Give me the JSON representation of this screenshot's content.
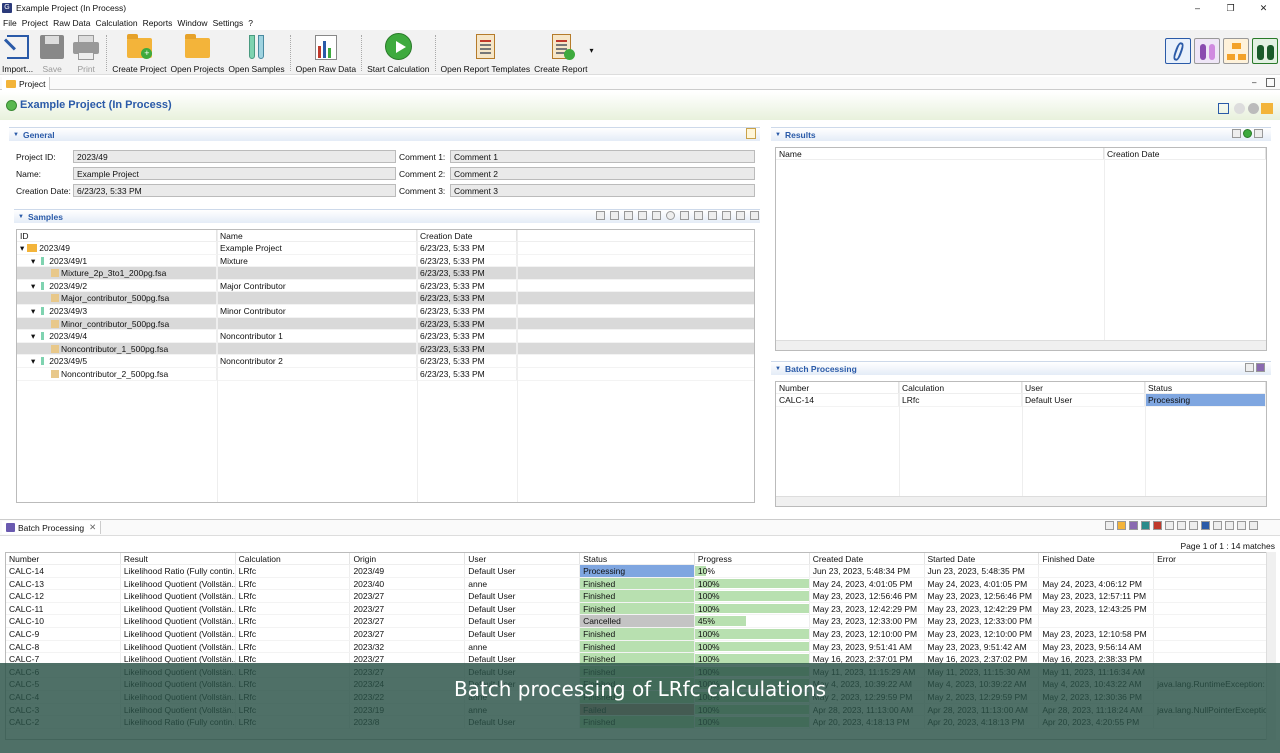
{
  "window": {
    "title": "Example Project (In Process)",
    "app_icon": "G"
  },
  "menu": [
    "File",
    "Project",
    "Raw Data",
    "Calculation",
    "Reports",
    "Window",
    "Settings",
    "?"
  ],
  "toolbar": {
    "import": "Import...",
    "save": "Save",
    "print": "Print",
    "create_project": "Create Project",
    "open_projects": "Open Projects",
    "open_samples": "Open Samples",
    "open_raw_data": "Open Raw Data",
    "start_calculation": "Start Calculation",
    "open_report_templates": "Open Report Templates",
    "create_report": "Create Report"
  },
  "project_tab": "Project",
  "project_title": "Example Project (In Process)",
  "general": {
    "header": "General",
    "project_id_label": "Project ID:",
    "project_id": "2023/49",
    "name_label": "Name:",
    "name": "Example Project",
    "creation_label": "Creation Date:",
    "creation": "6/23/23, 5:33 PM",
    "c1_label": "Comment 1:",
    "c1": "Comment 1",
    "c2_label": "Comment 2:",
    "c2": "Comment 2",
    "c3_label": "Comment 3:",
    "c3": "Comment 3"
  },
  "samples": {
    "header": "Samples",
    "cols": [
      "ID",
      "Name",
      "Creation Date"
    ],
    "rows": [
      {
        "id": "2023/49",
        "name": "Example Project",
        "date": "6/23/23, 5:33 PM",
        "level": 0,
        "kind": "folder"
      },
      {
        "id": "2023/49/1",
        "name": "Mixture",
        "date": "6/23/23, 5:33 PM",
        "level": 1,
        "kind": "tube"
      },
      {
        "id": "Mixture_2p_3to1_200pg.fsa",
        "name": "",
        "date": "6/23/23, 5:33 PM",
        "level": 2,
        "kind": "file",
        "sel": true
      },
      {
        "id": "2023/49/2",
        "name": "Major Contributor",
        "date": "6/23/23, 5:33 PM",
        "level": 1,
        "kind": "tube"
      },
      {
        "id": "Major_contributor_500pg.fsa",
        "name": "",
        "date": "6/23/23, 5:33 PM",
        "level": 2,
        "kind": "file",
        "sel": true
      },
      {
        "id": "2023/49/3",
        "name": "Minor Contributor",
        "date": "6/23/23, 5:33 PM",
        "level": 1,
        "kind": "tube"
      },
      {
        "id": "Minor_contributor_500pg.fsa",
        "name": "",
        "date": "6/23/23, 5:33 PM",
        "level": 2,
        "kind": "file",
        "sel": true
      },
      {
        "id": "2023/49/4",
        "name": "Noncontributor 1",
        "date": "6/23/23, 5:33 PM",
        "level": 1,
        "kind": "tube"
      },
      {
        "id": "Noncontributor_1_500pg.fsa",
        "name": "",
        "date": "6/23/23, 5:33 PM",
        "level": 2,
        "kind": "file",
        "sel": true
      },
      {
        "id": "2023/49/5",
        "name": "Noncontributor 2",
        "date": "6/23/23, 5:33 PM",
        "level": 1,
        "kind": "tube"
      },
      {
        "id": "Noncontributor_2_500pg.fsa",
        "name": "",
        "date": "6/23/23, 5:33 PM",
        "level": 2,
        "kind": "file"
      }
    ]
  },
  "results": {
    "header": "Results",
    "cols": [
      "Name",
      "Creation Date"
    ]
  },
  "batch_small": {
    "header": "Batch Processing",
    "cols": [
      "Number",
      "Calculation",
      "User",
      "Status"
    ],
    "rows": [
      {
        "number": "CALC-14",
        "calc": "LRfc",
        "user": "Default User",
        "status": "Processing"
      }
    ]
  },
  "batch": {
    "tab": "Batch Processing",
    "page_info": "Page 1 of 1 : 14 matches",
    "cols": [
      "Number",
      "Result",
      "Calculation",
      "Origin",
      "User",
      "Status",
      "Progress",
      "Created Date",
      "Started Date",
      "Finished Date",
      "Error"
    ],
    "rows": [
      {
        "number": "CALC-14",
        "result": "Likelihood Ratio (Fully contin...",
        "calc": "LRfc",
        "origin": "2023/49",
        "user": "Default User",
        "status": "Processing",
        "progress": "10%",
        "pct": 10,
        "created": "Jun 23, 2023, 5:48:34 PM",
        "started": "Jun 23, 2023, 5:48:35 PM",
        "finished": "",
        "error": ""
      },
      {
        "number": "CALC-13",
        "result": "Likelihood Quotient (Vollstän...",
        "calc": "LRfc",
        "origin": "2023/40",
        "user": "anne",
        "status": "Finished",
        "progress": "100%",
        "pct": 100,
        "created": "May 24, 2023, 4:01:05 PM",
        "started": "May 24, 2023, 4:01:05 PM",
        "finished": "May 24, 2023, 4:06:12 PM",
        "error": ""
      },
      {
        "number": "CALC-12",
        "result": "Likelihood Quotient (Vollstän...",
        "calc": "LRfc",
        "origin": "2023/27",
        "user": "Default User",
        "status": "Finished",
        "progress": "100%",
        "pct": 100,
        "created": "May 23, 2023, 12:56:46 PM",
        "started": "May 23, 2023, 12:56:46 PM",
        "finished": "May 23, 2023, 12:57:11 PM",
        "error": ""
      },
      {
        "number": "CALC-11",
        "result": "Likelihood Quotient (Vollstän...",
        "calc": "LRfc",
        "origin": "2023/27",
        "user": "Default User",
        "status": "Finished",
        "progress": "100%",
        "pct": 100,
        "created": "May 23, 2023, 12:42:29 PM",
        "started": "May 23, 2023, 12:42:29 PM",
        "finished": "May 23, 2023, 12:43:25 PM",
        "error": ""
      },
      {
        "number": "CALC-10",
        "result": "Likelihood Quotient (Vollstän...",
        "calc": "LRfc",
        "origin": "2023/27",
        "user": "Default User",
        "status": "Cancelled",
        "progress": "45%",
        "pct": 45,
        "created": "May 23, 2023, 12:33:00 PM",
        "started": "May 23, 2023, 12:33:00 PM",
        "finished": "",
        "error": ""
      },
      {
        "number": "CALC-9",
        "result": "Likelihood Quotient (Vollstän...",
        "calc": "LRfc",
        "origin": "2023/27",
        "user": "Default User",
        "status": "Finished",
        "progress": "100%",
        "pct": 100,
        "created": "May 23, 2023, 12:10:00 PM",
        "started": "May 23, 2023, 12:10:00 PM",
        "finished": "May 23, 2023, 12:10:58 PM",
        "error": ""
      },
      {
        "number": "CALC-8",
        "result": "Likelihood Quotient (Vollstän...",
        "calc": "LRfc",
        "origin": "2023/32",
        "user": "anne",
        "status": "Finished",
        "progress": "100%",
        "pct": 100,
        "created": "May 23, 2023, 9:51:41 AM",
        "started": "May 23, 2023, 9:51:42 AM",
        "finished": "May 23, 2023, 9:56:14 AM",
        "error": ""
      },
      {
        "number": "CALC-7",
        "result": "Likelihood Quotient (Vollstän...",
        "calc": "LRfc",
        "origin": "2023/27",
        "user": "Default User",
        "status": "Finished",
        "progress": "100%",
        "pct": 100,
        "created": "May 16, 2023, 2:37:01 PM",
        "started": "May 16, 2023, 2:37:02 PM",
        "finished": "May 16, 2023, 2:38:33 PM",
        "error": ""
      },
      {
        "number": "CALC-6",
        "result": "Likelihood Quotient (Vollstän...",
        "calc": "LRfc",
        "origin": "2023/27",
        "user": "Default User",
        "status": "Finished",
        "progress": "100%",
        "pct": 100,
        "created": "May 11, 2023, 11:15:29 AM",
        "started": "May 11, 2023, 11:15:30 AM",
        "finished": "May 11, 2023, 11:16:34 AM",
        "error": ""
      },
      {
        "number": "CALC-5",
        "result": "Likelihood Quotient (Vollstän...",
        "calc": "LRfc",
        "origin": "2023/24",
        "user": "Default User",
        "status": "Finished",
        "progress": "100%",
        "pct": 100,
        "created": "May 4, 2023, 10:39:22 AM",
        "started": "May 4, 2023, 10:39:22 AM",
        "finished": "May 4, 2023, 10:43:22 AM",
        "error": "java.lang.RuntimeException:"
      },
      {
        "number": "CALC-4",
        "result": "Likelihood Quotient (Vollstän...",
        "calc": "LRfc",
        "origin": "2023/22",
        "user": "anne",
        "status": "Finished",
        "progress": "100%",
        "pct": 100,
        "created": "May 2, 2023, 12:29:59 PM",
        "started": "May 2, 2023, 12:29:59 PM",
        "finished": "May 2, 2023, 12:30:36 PM",
        "error": ""
      },
      {
        "number": "CALC-3",
        "result": "Likelihood Quotient (Vollstän...",
        "calc": "LRfc",
        "origin": "2023/19",
        "user": "anne",
        "status": "Failed",
        "progress": "100%",
        "pct": 100,
        "created": "Apr 28, 2023, 11:13:00 AM",
        "started": "Apr 28, 2023, 11:13:00 AM",
        "finished": "Apr 28, 2023, 11:18:24 AM",
        "error": "java.lang.NullPointerException"
      },
      {
        "number": "CALC-2",
        "result": "Likelihood Ratio (Fully contin...",
        "calc": "LRfc",
        "origin": "2023/8",
        "user": "Default User",
        "status": "Finished",
        "progress": "100%",
        "pct": 100,
        "created": "Apr 20, 2023, 4:18:13 PM",
        "started": "Apr 20, 2023, 4:18:13 PM",
        "finished": "Apr 20, 2023, 4:20:55 PM",
        "error": ""
      }
    ]
  },
  "caption": "Batch processing of LRfc calculations"
}
